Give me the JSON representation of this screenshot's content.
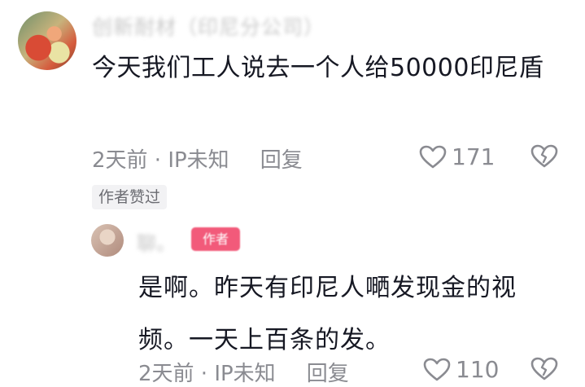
{
  "comments": [
    {
      "username": "创新耐材（印尼分公司）",
      "text": "今天我们工人说去一个人给50000印尼盾",
      "time": "2天前 · IP未知",
      "reply_label": "回复",
      "likes": "171",
      "author_liked_label": "作者赞过"
    }
  ],
  "reply": {
    "username": "聊。",
    "author_badge": "作者",
    "text": "是啊。昨天有印尼人嗮发现金的视频。一天上百条的发。",
    "time": "2天前 · IP未知",
    "reply_label": "回复",
    "likes": "110"
  },
  "icons": {
    "like": "heart-outline-icon",
    "dislike": "broken-heart-icon"
  },
  "colors": {
    "text_primary": "#161823",
    "text_secondary": "#8a8b91",
    "author_badge": "#f25a7a"
  }
}
